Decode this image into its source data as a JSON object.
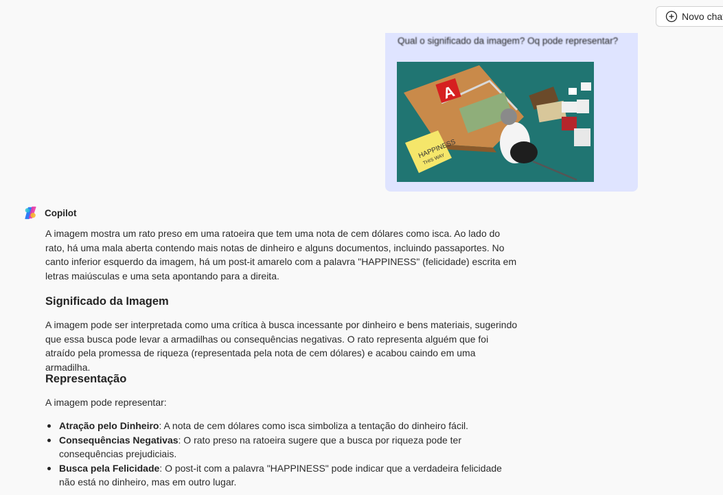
{
  "header": {
    "new_chat_label": "Novo chat"
  },
  "user_message": {
    "question": "Qual o significado da imagem? Oq pode representar?",
    "image": {
      "name": "rat-trap-happiness-illustration",
      "note_text_1": "HAPPINESS",
      "note_text_2": "THIS WAY",
      "sign_letter": "A"
    }
  },
  "assistant": {
    "name": "Copilot",
    "intro": "A imagem mostra um rato preso em uma ratoeira que tem uma nota de cem dólares como isca. Ao lado do rato, há uma mala aberta contendo mais notas de dinheiro e alguns documentos, incluindo passaportes. No canto inferior esquerdo da imagem, há um post-it amarelo com a palavra \"HAPPINESS\" (felicidade) escrita em letras maiúsculas e uma seta apontando para a direita.",
    "section1_title": "Significado da Imagem",
    "section1_text": "A imagem pode ser interpretada como uma crítica à busca incessante por dinheiro e bens materiais, sugerindo que essa busca pode levar a armadilhas ou consequências negativas. O rato representa alguém que foi atraído pela promessa de riqueza (representada pela nota de cem dólares) e acabou caindo em uma armadilha.",
    "section2_title": "Representação",
    "section2_intro": "A imagem pode representar:",
    "bullets": [
      {
        "term": "Atração pelo Dinheiro",
        "text": ": A nota de cem dólares como isca simboliza a tentação do dinheiro fácil."
      },
      {
        "term": "Consequências Negativas",
        "text": ": O rato preso na ratoeira sugere que a busca por riqueza pode ter consequências prejudiciais."
      },
      {
        "term": "Busca pela Felicidade",
        "text": ": O post-it com a palavra \"HAPPINESS\" pode indicar que a verdadeira felicidade não está no dinheiro, mas em outro lugar."
      }
    ]
  },
  "colors": {
    "background": "#f9f9f9",
    "user_bubble": "#dfe4ff",
    "image_teal": "#237c78"
  }
}
